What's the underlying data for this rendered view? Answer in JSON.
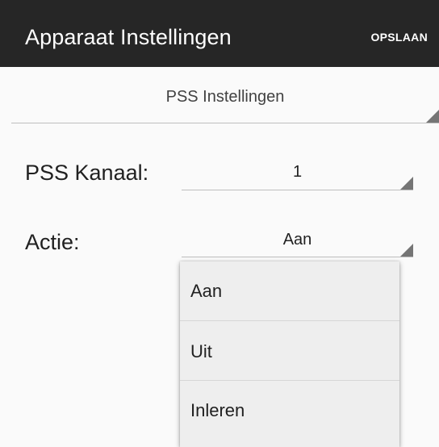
{
  "toolbar": {
    "title": "Apparaat Instellingen",
    "save_label": "OPSLAAN"
  },
  "section": {
    "selected": "PSS Instellingen"
  },
  "form": {
    "channel": {
      "label": "PSS Kanaal:",
      "value": "1"
    },
    "action": {
      "label": "Actie:",
      "value": "Aan"
    }
  },
  "dropdown": {
    "options": [
      "Aan",
      "Uit",
      "Inleren"
    ]
  },
  "colors": {
    "toolbar_bg": "#262626",
    "page_bg": "#fafafa",
    "dropdown_bg": "#eeeeee"
  }
}
